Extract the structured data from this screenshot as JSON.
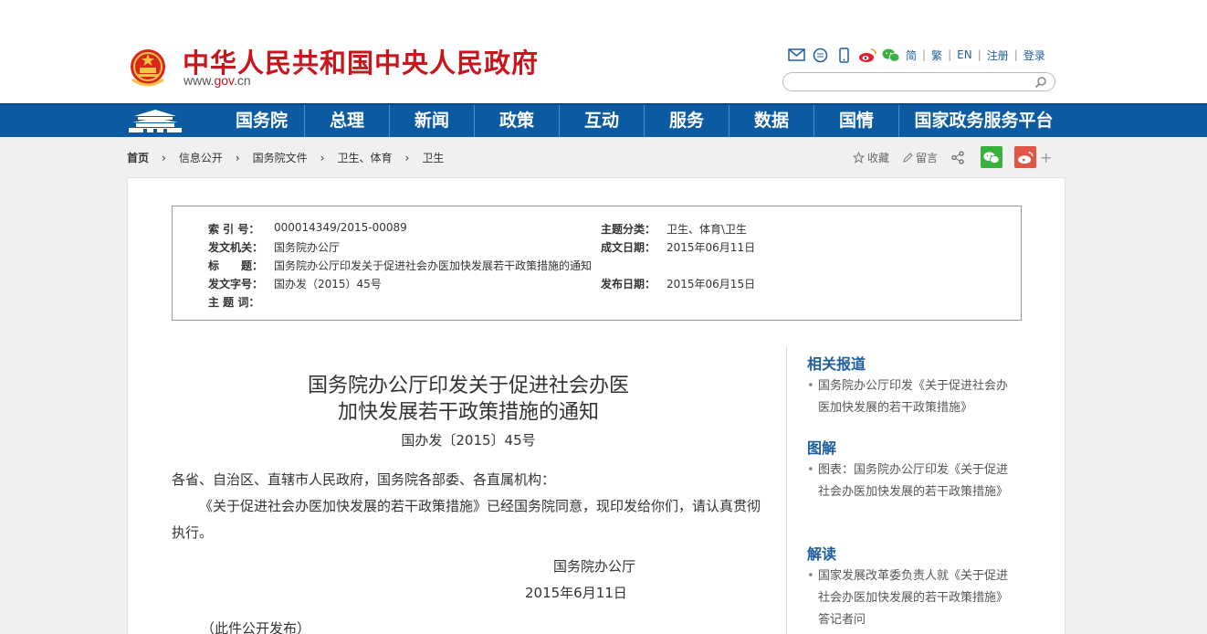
{
  "header": {
    "site_title": "中华人民共和国中央人民政府",
    "site_url_prefix": "www.",
    "site_url_brand": "gov",
    "site_url_suffix": ".cn",
    "toplinks": [
      "简",
      "繁",
      "EN",
      "注册",
      "登录"
    ],
    "search_placeholder": ""
  },
  "nav": {
    "items": [
      "国务院",
      "总理",
      "新闻",
      "政策",
      "互动",
      "服务",
      "数据",
      "国情",
      "国家政务服务平台"
    ]
  },
  "breadcrumb": [
    "首页",
    "信息公开",
    "国务院文件",
    "卫生、体育",
    "卫生"
  ],
  "tools": {
    "favorite": "收藏",
    "comment": "留言",
    "plus": "+"
  },
  "meta": {
    "index_label": "索 引 号：",
    "index_value": "000014349/2015-00089",
    "topic_label": "主题分类：",
    "topic_value": "卫生、体育\\卫生",
    "issuer_label": "发文机关：",
    "issuer_value": "国务院办公厅",
    "date_label": "成文日期：",
    "date_value": "2015年06月11日",
    "title_label": "标　　题：",
    "title_value": "国务院办公厅印发关于促进社会办医加快发展若干政策措施的通知",
    "docno_label": "发文字号：",
    "docno_value": "国办发（2015）45号",
    "pubdate_label": "发布日期：",
    "pubdate_value": "2015年06月15日",
    "keywords_label": "主 题 词：",
    "keywords_value": ""
  },
  "article": {
    "title_line1": "国务院办公厅印发关于促进社会办医",
    "title_line2": "加快发展若干政策措施的通知",
    "doc_number": "国办发〔2015〕45号",
    "salutation": "各省、自治区、直辖市人民政府，国务院各部委、各直属机构：",
    "body": "《关于促进社会办医加快发展的若干政策措施》已经国务院同意，现印发给你们，请认真贯彻执行。",
    "signer": "国务院办公厅",
    "sign_date": "2015年6月11日",
    "note": "（此件公开发布）"
  },
  "sidebar": {
    "sections": [
      {
        "heading": "相关报道",
        "item": "国务院办公厅印发《关于促进社会办医加快发展的若干政策措施》"
      },
      {
        "heading": "图解",
        "item": "图表：国务院办公厅印发《关于促进社会办医加快发展的若干政策措施》"
      },
      {
        "heading": "解读",
        "item": "国家发展改革委负责人就《关于促进社会办医加快发展的若干政策措施》答记者问"
      }
    ]
  }
}
